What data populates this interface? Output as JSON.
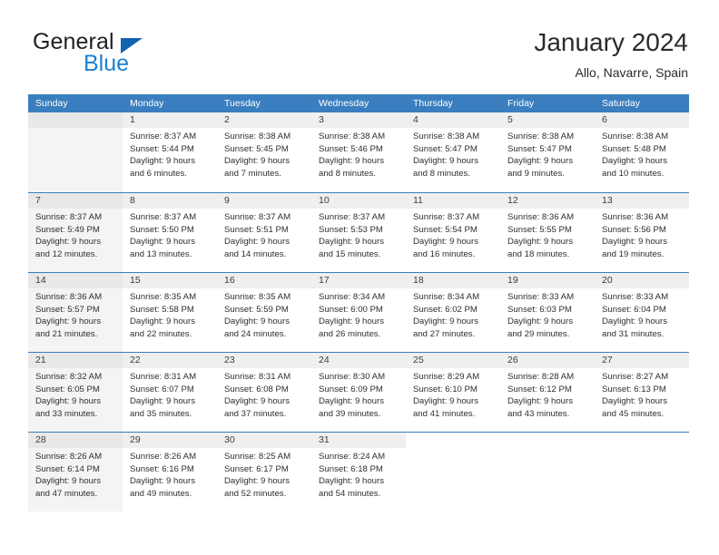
{
  "brand": {
    "word1": "General",
    "word2": "Blue",
    "triangle_color": "#1263b0",
    "blue_color": "#1c7fd4"
  },
  "header": {
    "title": "January 2024",
    "subtitle": "Allo, Navarre, Spain"
  },
  "theme": {
    "header_blue": "#3a7ebf",
    "daynum_band": "#efefef",
    "sunday_shade": "#f4f4f4"
  },
  "weekdays": [
    "Sunday",
    "Monday",
    "Tuesday",
    "Wednesday",
    "Thursday",
    "Friday",
    "Saturday"
  ],
  "weeks": [
    [
      {
        "day": "",
        "lines": []
      },
      {
        "day": "1",
        "lines": [
          "Sunrise: 8:37 AM",
          "Sunset: 5:44 PM",
          "Daylight: 9 hours",
          "and 6 minutes."
        ]
      },
      {
        "day": "2",
        "lines": [
          "Sunrise: 8:38 AM",
          "Sunset: 5:45 PM",
          "Daylight: 9 hours",
          "and 7 minutes."
        ]
      },
      {
        "day": "3",
        "lines": [
          "Sunrise: 8:38 AM",
          "Sunset: 5:46 PM",
          "Daylight: 9 hours",
          "and 8 minutes."
        ]
      },
      {
        "day": "4",
        "lines": [
          "Sunrise: 8:38 AM",
          "Sunset: 5:47 PM",
          "Daylight: 9 hours",
          "and 8 minutes."
        ]
      },
      {
        "day": "5",
        "lines": [
          "Sunrise: 8:38 AM",
          "Sunset: 5:47 PM",
          "Daylight: 9 hours",
          "and 9 minutes."
        ]
      },
      {
        "day": "6",
        "lines": [
          "Sunrise: 8:38 AM",
          "Sunset: 5:48 PM",
          "Daylight: 9 hours",
          "and 10 minutes."
        ]
      }
    ],
    [
      {
        "day": "7",
        "lines": [
          "Sunrise: 8:37 AM",
          "Sunset: 5:49 PM",
          "Daylight: 9 hours",
          "and 12 minutes."
        ]
      },
      {
        "day": "8",
        "lines": [
          "Sunrise: 8:37 AM",
          "Sunset: 5:50 PM",
          "Daylight: 9 hours",
          "and 13 minutes."
        ]
      },
      {
        "day": "9",
        "lines": [
          "Sunrise: 8:37 AM",
          "Sunset: 5:51 PM",
          "Daylight: 9 hours",
          "and 14 minutes."
        ]
      },
      {
        "day": "10",
        "lines": [
          "Sunrise: 8:37 AM",
          "Sunset: 5:53 PM",
          "Daylight: 9 hours",
          "and 15 minutes."
        ]
      },
      {
        "day": "11",
        "lines": [
          "Sunrise: 8:37 AM",
          "Sunset: 5:54 PM",
          "Daylight: 9 hours",
          "and 16 minutes."
        ]
      },
      {
        "day": "12",
        "lines": [
          "Sunrise: 8:36 AM",
          "Sunset: 5:55 PM",
          "Daylight: 9 hours",
          "and 18 minutes."
        ]
      },
      {
        "day": "13",
        "lines": [
          "Sunrise: 8:36 AM",
          "Sunset: 5:56 PM",
          "Daylight: 9 hours",
          "and 19 minutes."
        ]
      }
    ],
    [
      {
        "day": "14",
        "lines": [
          "Sunrise: 8:36 AM",
          "Sunset: 5:57 PM",
          "Daylight: 9 hours",
          "and 21 minutes."
        ]
      },
      {
        "day": "15",
        "lines": [
          "Sunrise: 8:35 AM",
          "Sunset: 5:58 PM",
          "Daylight: 9 hours",
          "and 22 minutes."
        ]
      },
      {
        "day": "16",
        "lines": [
          "Sunrise: 8:35 AM",
          "Sunset: 5:59 PM",
          "Daylight: 9 hours",
          "and 24 minutes."
        ]
      },
      {
        "day": "17",
        "lines": [
          "Sunrise: 8:34 AM",
          "Sunset: 6:00 PM",
          "Daylight: 9 hours",
          "and 26 minutes."
        ]
      },
      {
        "day": "18",
        "lines": [
          "Sunrise: 8:34 AM",
          "Sunset: 6:02 PM",
          "Daylight: 9 hours",
          "and 27 minutes."
        ]
      },
      {
        "day": "19",
        "lines": [
          "Sunrise: 8:33 AM",
          "Sunset: 6:03 PM",
          "Daylight: 9 hours",
          "and 29 minutes."
        ]
      },
      {
        "day": "20",
        "lines": [
          "Sunrise: 8:33 AM",
          "Sunset: 6:04 PM",
          "Daylight: 9 hours",
          "and 31 minutes."
        ]
      }
    ],
    [
      {
        "day": "21",
        "lines": [
          "Sunrise: 8:32 AM",
          "Sunset: 6:05 PM",
          "Daylight: 9 hours",
          "and 33 minutes."
        ]
      },
      {
        "day": "22",
        "lines": [
          "Sunrise: 8:31 AM",
          "Sunset: 6:07 PM",
          "Daylight: 9 hours",
          "and 35 minutes."
        ]
      },
      {
        "day": "23",
        "lines": [
          "Sunrise: 8:31 AM",
          "Sunset: 6:08 PM",
          "Daylight: 9 hours",
          "and 37 minutes."
        ]
      },
      {
        "day": "24",
        "lines": [
          "Sunrise: 8:30 AM",
          "Sunset: 6:09 PM",
          "Daylight: 9 hours",
          "and 39 minutes."
        ]
      },
      {
        "day": "25",
        "lines": [
          "Sunrise: 8:29 AM",
          "Sunset: 6:10 PM",
          "Daylight: 9 hours",
          "and 41 minutes."
        ]
      },
      {
        "day": "26",
        "lines": [
          "Sunrise: 8:28 AM",
          "Sunset: 6:12 PM",
          "Daylight: 9 hours",
          "and 43 minutes."
        ]
      },
      {
        "day": "27",
        "lines": [
          "Sunrise: 8:27 AM",
          "Sunset: 6:13 PM",
          "Daylight: 9 hours",
          "and 45 minutes."
        ]
      }
    ],
    [
      {
        "day": "28",
        "lines": [
          "Sunrise: 8:26 AM",
          "Sunset: 6:14 PM",
          "Daylight: 9 hours",
          "and 47 minutes."
        ]
      },
      {
        "day": "29",
        "lines": [
          "Sunrise: 8:26 AM",
          "Sunset: 6:16 PM",
          "Daylight: 9 hours",
          "and 49 minutes."
        ]
      },
      {
        "day": "30",
        "lines": [
          "Sunrise: 8:25 AM",
          "Sunset: 6:17 PM",
          "Daylight: 9 hours",
          "and 52 minutes."
        ]
      },
      {
        "day": "31",
        "lines": [
          "Sunrise: 8:24 AM",
          "Sunset: 6:18 PM",
          "Daylight: 9 hours",
          "and 54 minutes."
        ]
      },
      {
        "day": "",
        "lines": []
      },
      {
        "day": "",
        "lines": []
      },
      {
        "day": "",
        "lines": []
      }
    ]
  ]
}
